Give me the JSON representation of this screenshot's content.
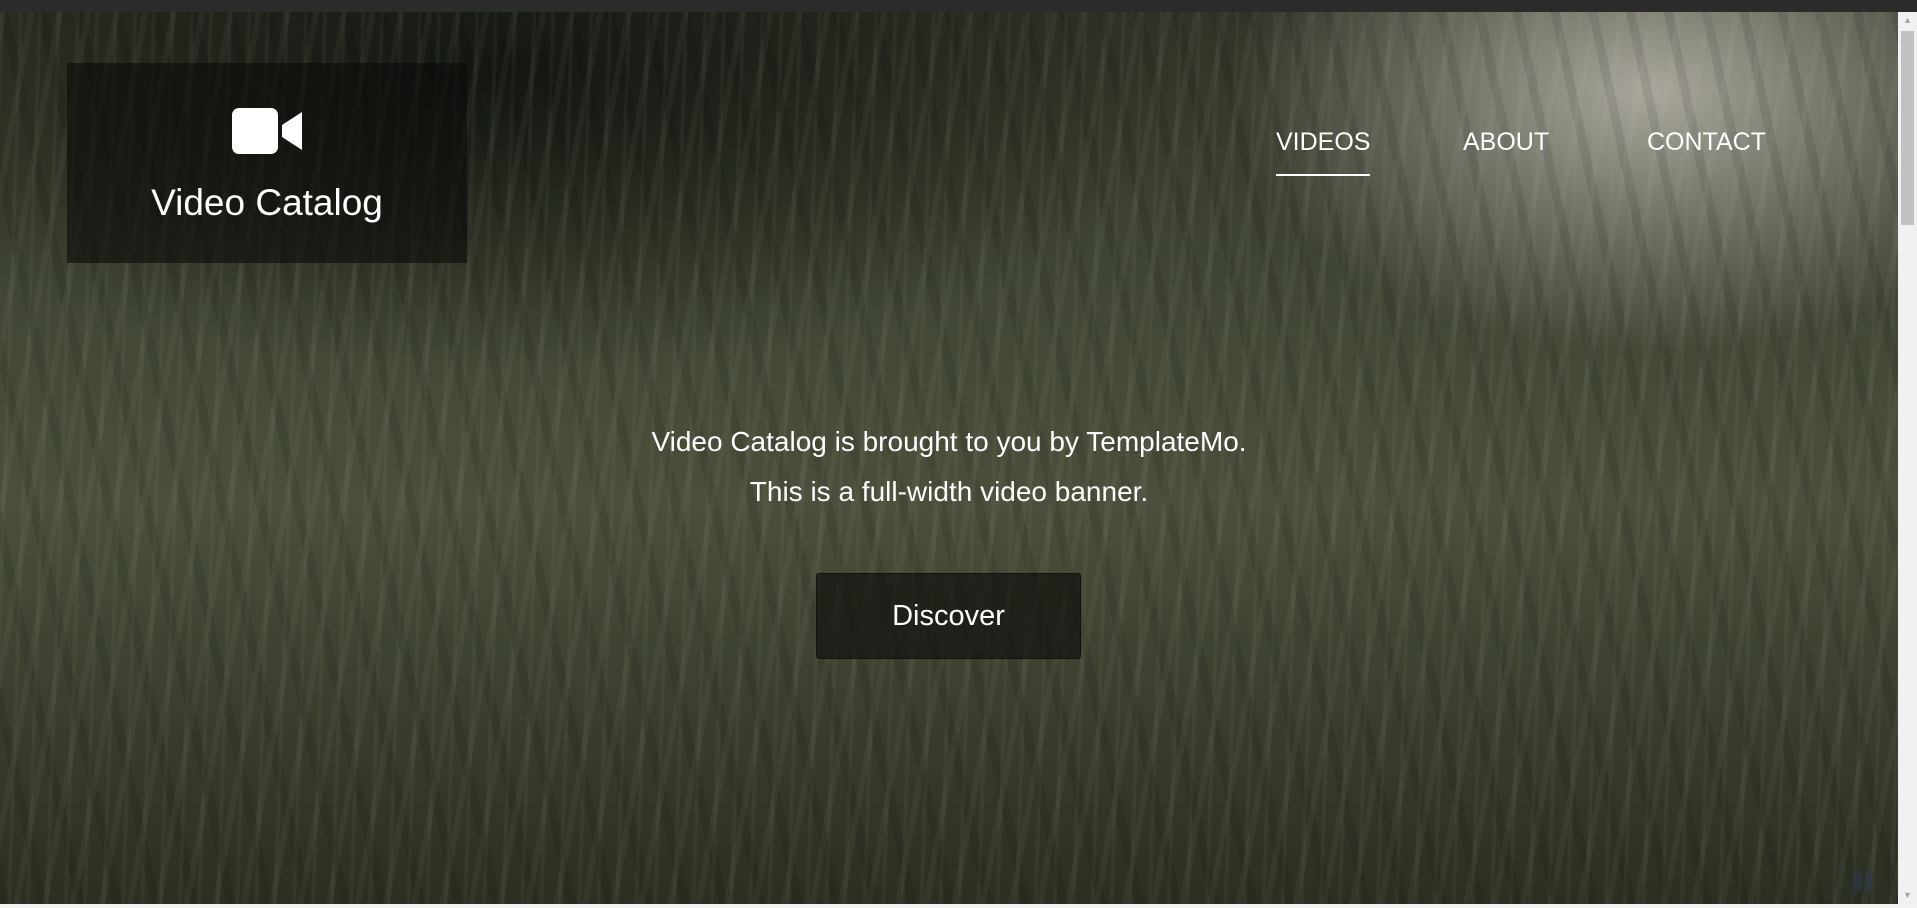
{
  "brand": {
    "icon": "video-camera-icon",
    "title": "Video Catalog"
  },
  "nav": {
    "items": [
      {
        "label": "VIDEOS",
        "active": true
      },
      {
        "label": "ABOUT",
        "active": false
      },
      {
        "label": "CONTACT",
        "active": false
      }
    ]
  },
  "hero": {
    "line1": "Video Catalog is brought to you by TemplateMo.",
    "line2": "This is a full-width video banner.",
    "button_label": "Discover"
  },
  "video_controls": {
    "pause_icon": "pause-icon"
  },
  "scrollbar": {
    "up_icon": "scroll-up-arrow-icon",
    "down_icon": "scroll-down-arrow-icon"
  },
  "colors": {
    "text": "#ffffff",
    "brand_box": "#0c0c0a",
    "scrollbar_track": "#f1f1f1",
    "scrollbar_thumb": "#c1c1c1"
  }
}
